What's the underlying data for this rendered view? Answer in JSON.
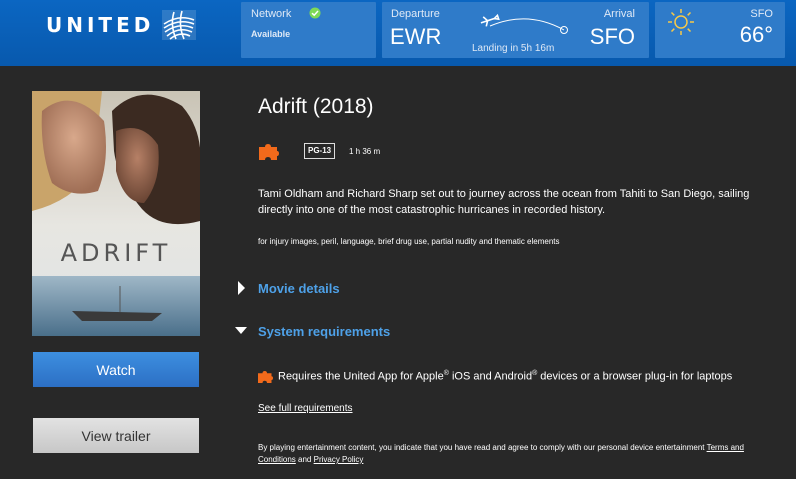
{
  "header": {
    "logo_text": "UNITED",
    "network": {
      "label": "Network",
      "status": "Available"
    },
    "flight": {
      "departure_label": "Departure",
      "departure_code": "EWR",
      "arrival_label": "Arrival",
      "arrival_code": "SFO",
      "landing": "Landing in 5h 16m"
    },
    "weather": {
      "city": "SFO",
      "temp": "66°"
    }
  },
  "poster": {
    "title": "ADRIFT"
  },
  "buttons": {
    "watch": "Watch",
    "trailer": "View trailer"
  },
  "movie": {
    "title": "Adrift (2018)",
    "rating": "PG-13",
    "duration": "1 h 36 m",
    "description": "Tami Oldham and Richard Sharp set out to journey across the ocean from Tahiti to San Diego, sailing directly into one of the most catastrophic hurricanes in recorded history.",
    "advisory": "for injury images, peril, language, brief drug use, partial nudity and thematic elements"
  },
  "sections": {
    "details": "Movie details",
    "system": "System requirements"
  },
  "requirements": {
    "text_1": "Requires the United App for Apple",
    "text_2": " iOS and Android",
    "text_3": " devices or a browser plug-in for laptops",
    "reg": "®",
    "see_full": "See full requirements"
  },
  "legal": {
    "text": "By playing entertainment content, you indicate that you have read and agree to comply with our personal device entertainment ",
    "terms": "Terms and Conditions",
    "and": " and ",
    "privacy": "Privacy Policy"
  },
  "colors": {
    "header_blue": "#0b66c2",
    "link_blue": "#4ea1e8",
    "accent_orange": "#f26a1b",
    "bg": "#282828"
  },
  "icons": [
    "united-globe-icon",
    "check-circle-icon",
    "plane-icon",
    "sun-icon",
    "puzzle-icon",
    "chevron-right-icon",
    "chevron-down-icon"
  ]
}
